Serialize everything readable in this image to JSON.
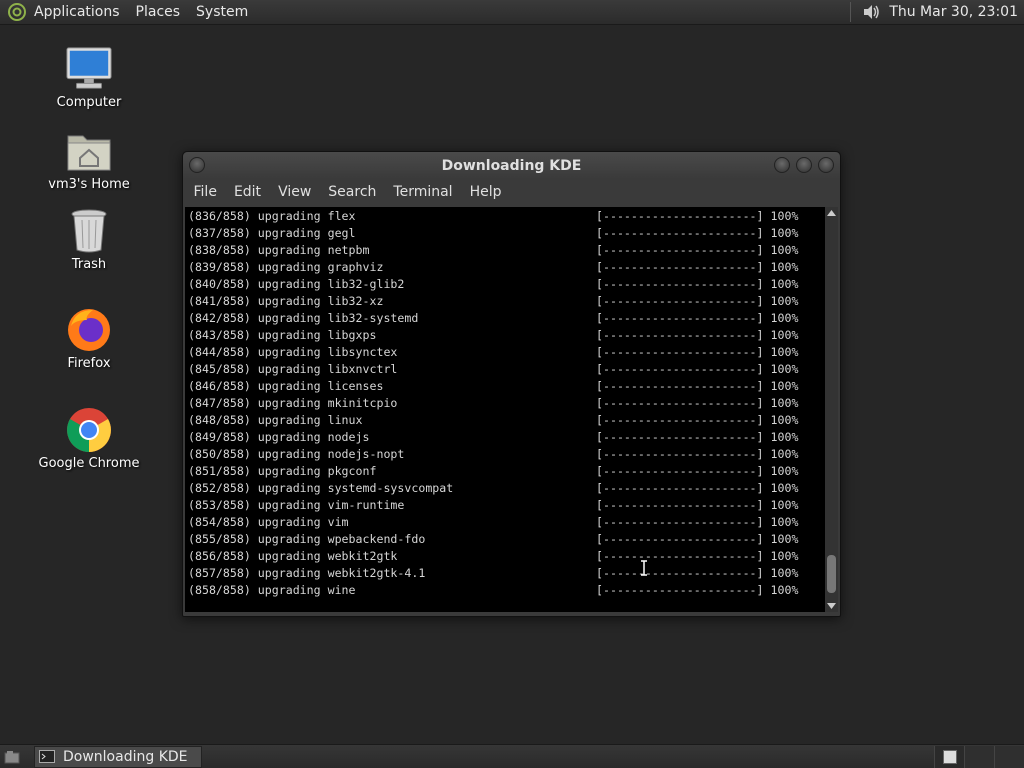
{
  "top_panel": {
    "menus": [
      "Applications",
      "Places",
      "System"
    ],
    "clock": "Thu Mar 30, 23:01",
    "icons": {
      "logo": "distro-logo-icon",
      "volume": "volume-icon"
    }
  },
  "desktop_icons": [
    {
      "label": "Computer",
      "icon": "computer-icon"
    },
    {
      "label": "vm3's Home",
      "icon": "home-folder-icon"
    },
    {
      "label": "Trash",
      "icon": "trash-icon"
    },
    {
      "label": "Firefox",
      "icon": "firefox-icon"
    },
    {
      "label": "Google Chrome",
      "icon": "chrome-icon"
    }
  ],
  "window": {
    "title": "Downloading KDE",
    "menu": [
      "File",
      "Edit",
      "View",
      "Search",
      "Terminal",
      "Help"
    ],
    "terminal_lines": [
      {
        "text": "(836/858) upgrading flex",
        "bar": "[----------------------] 100%"
      },
      {
        "text": "(837/858) upgrading gegl",
        "bar": "[----------------------] 100%"
      },
      {
        "text": "(838/858) upgrading netpbm",
        "bar": "[----------------------] 100%"
      },
      {
        "text": "(839/858) upgrading graphviz",
        "bar": "[----------------------] 100%"
      },
      {
        "text": "(840/858) upgrading lib32-glib2",
        "bar": "[----------------------] 100%"
      },
      {
        "text": "(841/858) upgrading lib32-xz",
        "bar": "[----------------------] 100%"
      },
      {
        "text": "(842/858) upgrading lib32-systemd",
        "bar": "[----------------------] 100%"
      },
      {
        "text": "(843/858) upgrading libgxps",
        "bar": "[----------------------] 100%"
      },
      {
        "text": "(844/858) upgrading libsynctex",
        "bar": "[----------------------] 100%"
      },
      {
        "text": "(845/858) upgrading libxnvctrl",
        "bar": "[----------------------] 100%"
      },
      {
        "text": "(846/858) upgrading licenses",
        "bar": "[----------------------] 100%"
      },
      {
        "text": "(847/858) upgrading mkinitcpio",
        "bar": "[----------------------] 100%"
      },
      {
        "text": "(848/858) upgrading linux",
        "bar": "[----------------------] 100%"
      },
      {
        "text": "(849/858) upgrading nodejs",
        "bar": "[----------------------] 100%"
      },
      {
        "text": "(850/858) upgrading nodejs-nopt",
        "bar": "[----------------------] 100%"
      },
      {
        "text": "(851/858) upgrading pkgconf",
        "bar": "[----------------------] 100%"
      },
      {
        "text": "(852/858) upgrading systemd-sysvcompat",
        "bar": "[----------------------] 100%"
      },
      {
        "text": "(853/858) upgrading vim-runtime",
        "bar": "[----------------------] 100%"
      },
      {
        "text": "(854/858) upgrading vim",
        "bar": "[----------------------] 100%"
      },
      {
        "text": "(855/858) upgrading wpebackend-fdo",
        "bar": "[----------------------] 100%"
      },
      {
        "text": "(856/858) upgrading webkit2gtk",
        "bar": "[----------------------] 100%"
      },
      {
        "text": "(857/858) upgrading webkit2gtk-4.1",
        "bar": "[----------------------] 100%"
      },
      {
        "text": "(858/858) upgrading wine",
        "bar": "[----------------------] 100%"
      }
    ]
  },
  "taskbar": {
    "tasks": [
      {
        "label": "Downloading KDE",
        "icon": "terminal-icon"
      }
    ]
  },
  "colors": {
    "desktop_bg": "#262626",
    "terminal_bg": "#000000",
    "terminal_fg": "#d6d6d6"
  }
}
